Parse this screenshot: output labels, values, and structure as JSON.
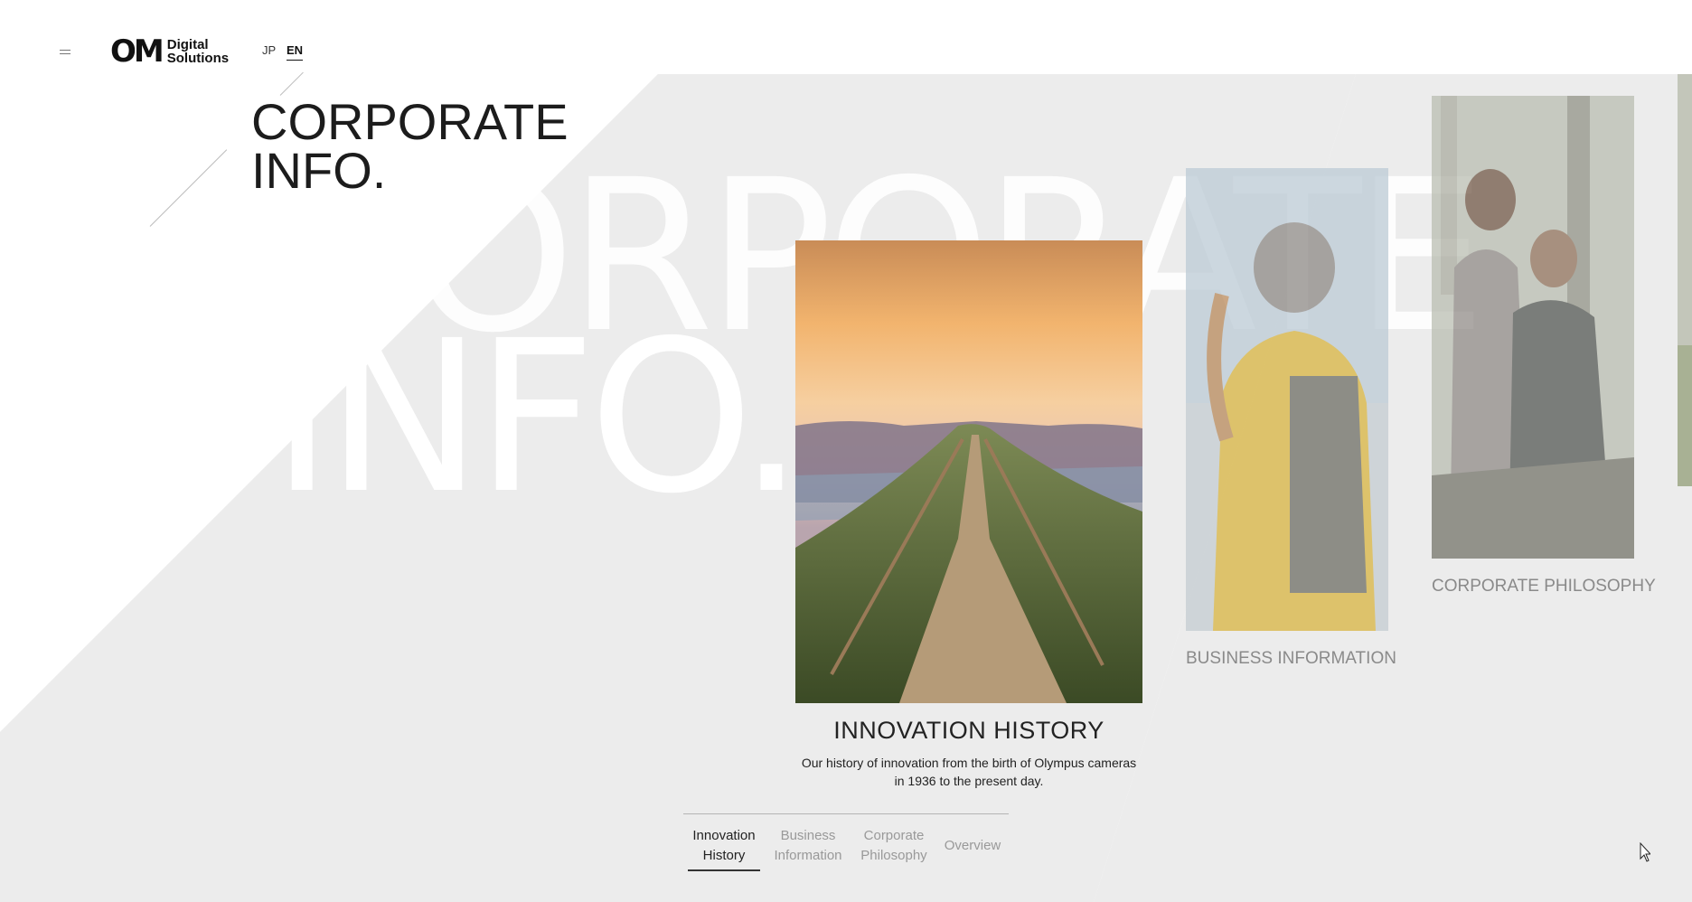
{
  "header": {
    "logo_mark": "OM",
    "logo_text_line1": "Digital",
    "logo_text_line2": "Solutions",
    "lang_jp": "JP",
    "lang_en": "EN"
  },
  "page": {
    "title_line1": "CORPORATE",
    "title_line2": "INFO.",
    "watermark_line1": "CORPORATE",
    "watermark_line2": "INFO."
  },
  "cards": {
    "main": {
      "title": "INNOVATION HISTORY",
      "description": "Our history of innovation from the birth of Olympus cameras in 1936 to the present day."
    },
    "business": {
      "title": "BUSINESS INFORMATION"
    },
    "philosophy": {
      "title": "CORPORATE PHILOSOPHY"
    }
  },
  "tabs": [
    {
      "line1": "Innovation",
      "line2": "History",
      "active": true
    },
    {
      "line1": "Business",
      "line2": "Information",
      "active": false
    },
    {
      "line1": "Corporate",
      "line2": "Philosophy",
      "active": false
    },
    {
      "line1": "Overview",
      "line2": "",
      "active": false
    }
  ],
  "colors": {
    "band": "#ececec",
    "text": "#222222",
    "muted": "#8a8a8a"
  }
}
